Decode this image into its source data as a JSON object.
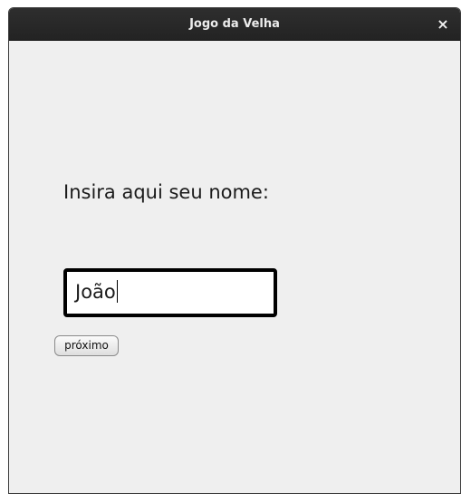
{
  "window": {
    "title": "Jogo da Velha",
    "close_glyph": "×"
  },
  "form": {
    "prompt_label": "Insira aqui seu nome:",
    "name_value": "João",
    "next_button_label": "próximo"
  },
  "colors": {
    "titlebar": "#2a2a2a",
    "background": "#efefef",
    "input_border": "#000000"
  }
}
